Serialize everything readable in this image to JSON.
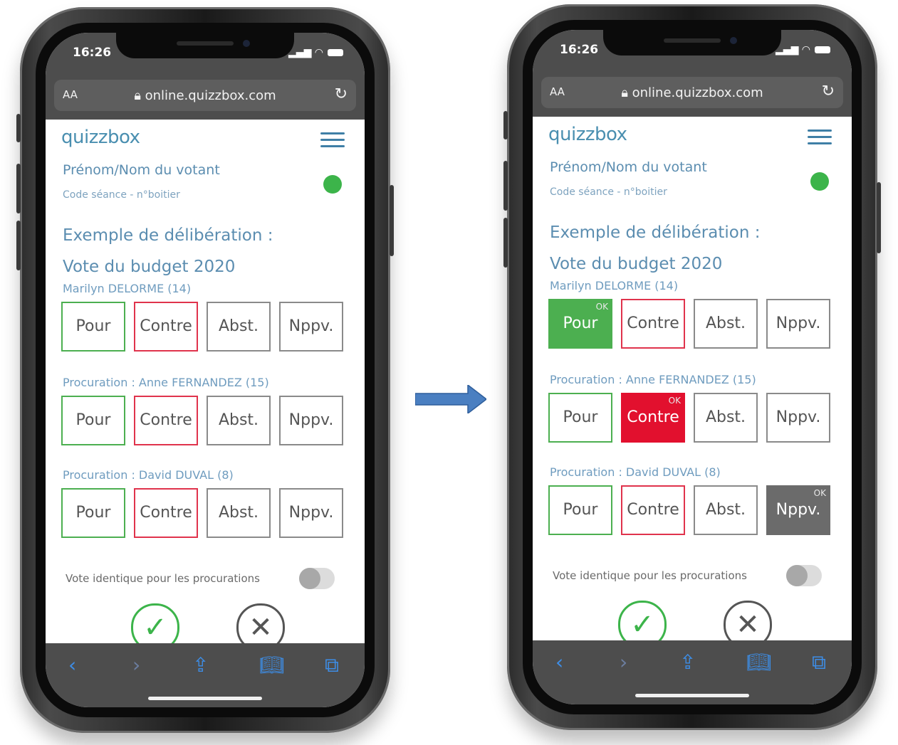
{
  "phones": [
    {
      "time": "16:26",
      "url": "online.quizzbox.com",
      "aa": "AA",
      "logo": "quizzbox",
      "voter": "Prénom/Nom du votant",
      "code": "Code séance - n°boitier",
      "delib1": "Exemple de délibération :",
      "delib2": "Vote du budget 2020",
      "groups": [
        {
          "label": "Marilyn DELORME (14)",
          "selected": null
        },
        {
          "label": "Procuration : Anne FERNANDEZ (15)",
          "selected": null
        },
        {
          "label": "Procuration : David DUVAL (8)",
          "selected": null
        }
      ],
      "same_vote": "Vote identique pour les procurations",
      "toggle_on": false
    },
    {
      "time": "16:26",
      "url": "online.quizzbox.com",
      "aa": "AA",
      "logo": "quizzbox",
      "voter": "Prénom/Nom du votant",
      "code": "Code séance - n°boitier",
      "delib1": "Exemple de délibération :",
      "delib2": "Vote du budget 2020",
      "groups": [
        {
          "label": "Marilyn DELORME (14)",
          "selected": "Pour"
        },
        {
          "label": "Procuration : Anne FERNANDEZ (15)",
          "selected": "Contre"
        },
        {
          "label": "Procuration : David DUVAL (8)",
          "selected": "Nppv."
        }
      ],
      "same_vote": "Vote identique pour les procurations",
      "toggle_on": false
    }
  ],
  "vote_options": [
    "Pour",
    "Contre",
    "Abst.",
    "Nppv."
  ],
  "ok_badge": "OK",
  "icons": {
    "confirm": "check-circle-icon",
    "cancel": "x-circle-icon",
    "back": "chevron-left-icon",
    "forward": "chevron-right-icon",
    "share": "share-icon",
    "bookmarks": "book-icon",
    "tabs": "tabs-icon",
    "lock": "lock-icon",
    "reload": "reload-icon",
    "menu": "hamburger-menu-icon",
    "transition_arrow": "right-arrow-icon"
  },
  "colors": {
    "pour": "#4caf50",
    "contre": "#e2102e",
    "nppv": "#6b6b6b",
    "brand_text": "#5b8db0",
    "status_dot": "#3cb44a",
    "arrow": "#4a7fc1"
  }
}
